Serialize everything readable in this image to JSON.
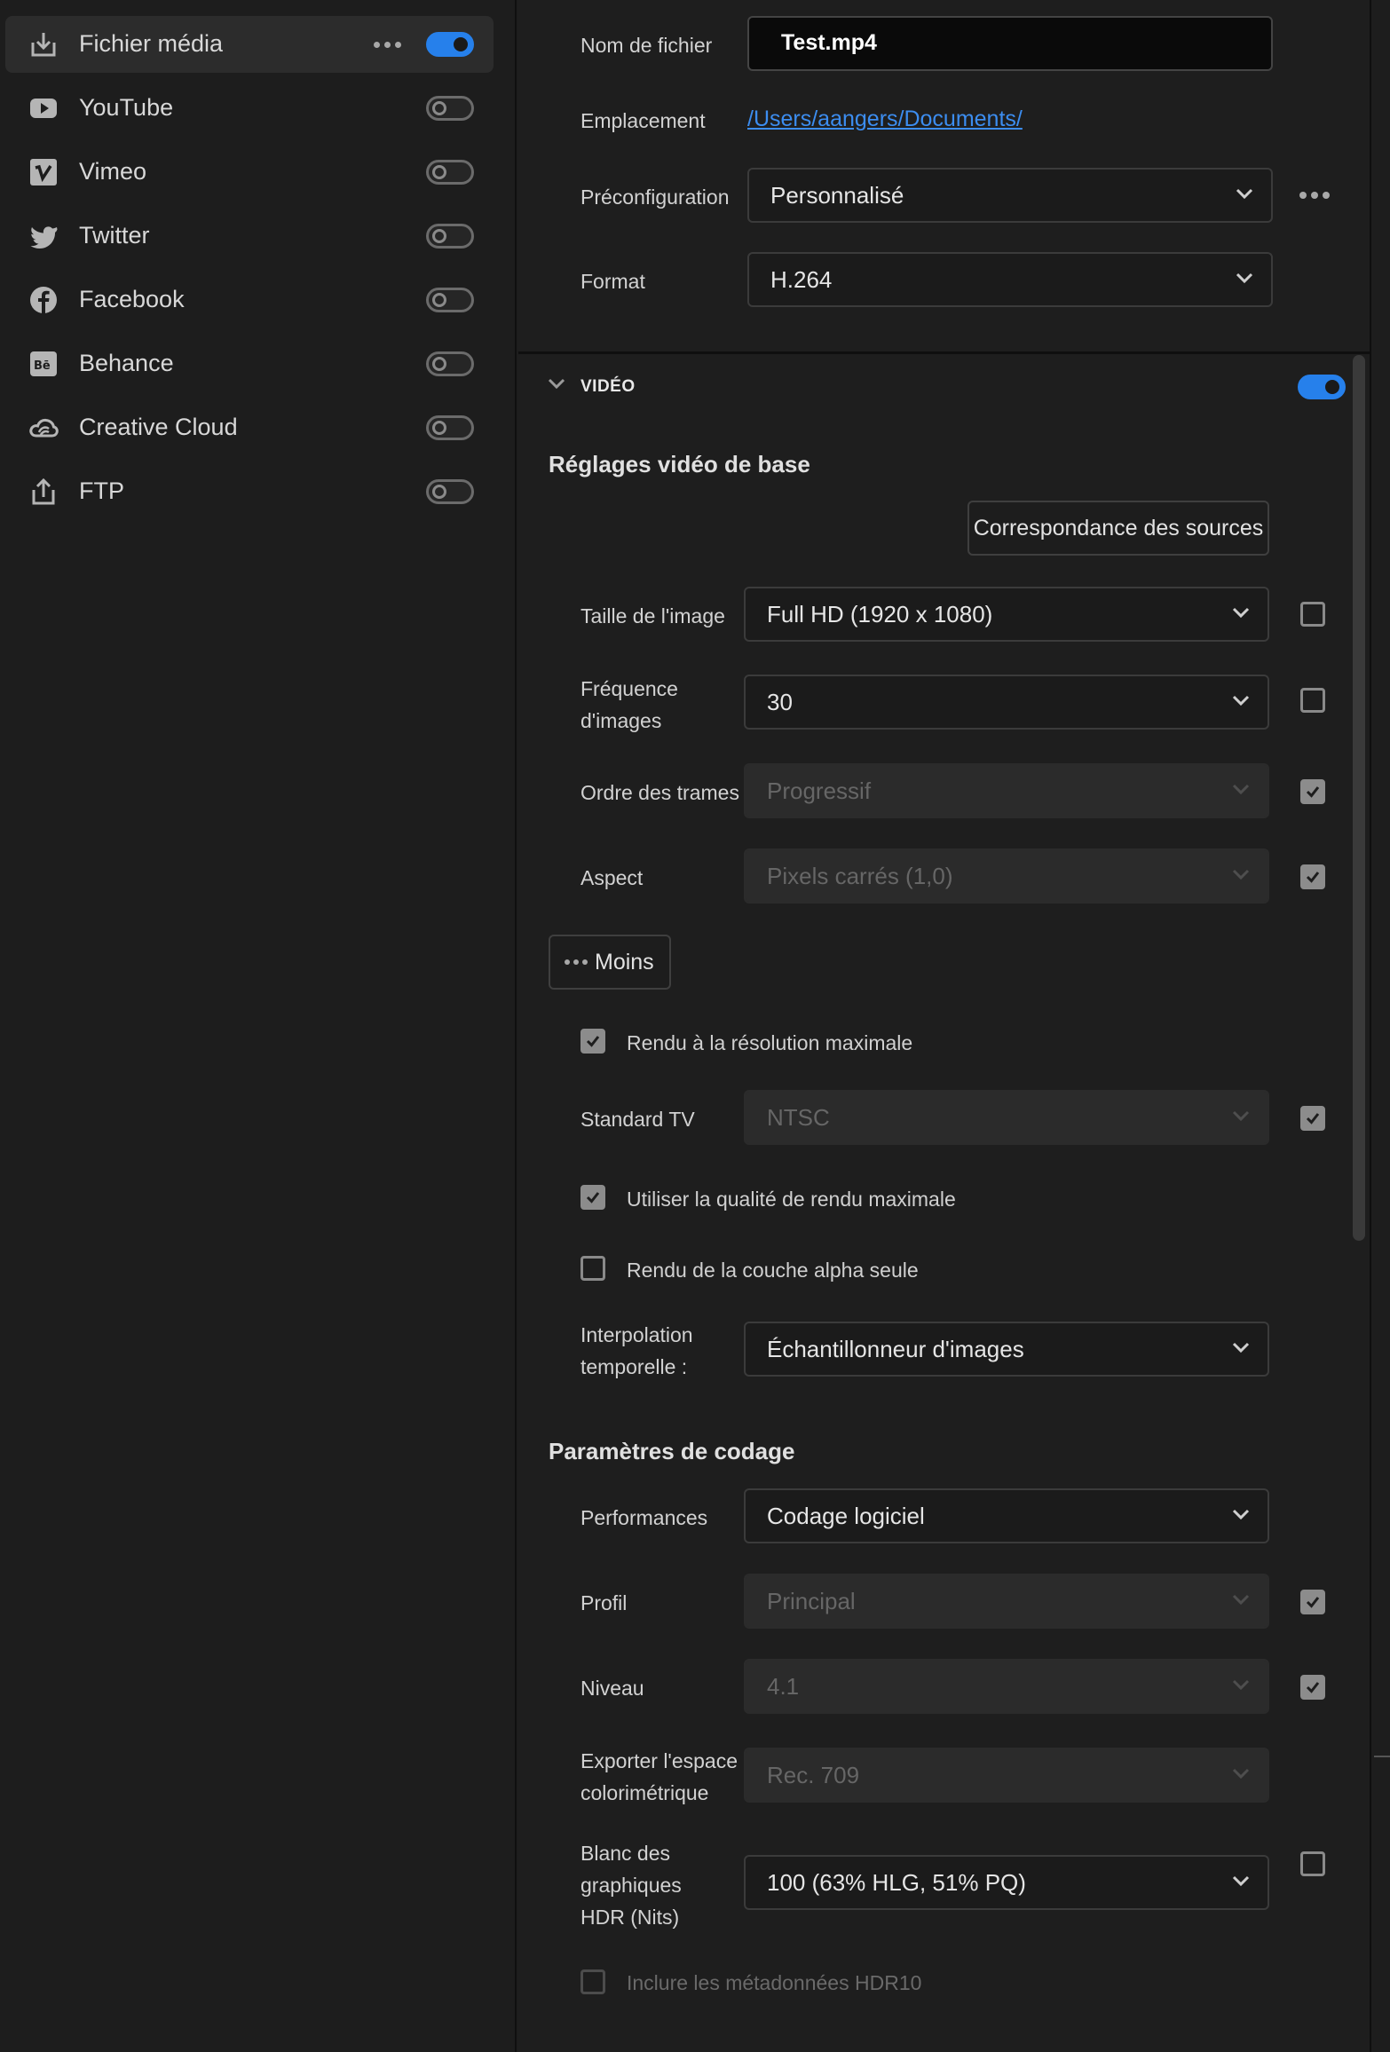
{
  "sidebar": {
    "items": [
      {
        "label": "Fichier média",
        "icon": "download-icon",
        "enabled": true,
        "active": true
      },
      {
        "label": "YouTube",
        "icon": "youtube-icon",
        "enabled": false
      },
      {
        "label": "Vimeo",
        "icon": "vimeo-icon",
        "enabled": false
      },
      {
        "label": "Twitter",
        "icon": "twitter-icon",
        "enabled": false
      },
      {
        "label": "Facebook",
        "icon": "facebook-icon",
        "enabled": false
      },
      {
        "label": "Behance",
        "icon": "behance-icon",
        "enabled": false
      },
      {
        "label": "Creative Cloud",
        "icon": "creative-cloud-icon",
        "enabled": false
      },
      {
        "label": "FTP",
        "icon": "upload-icon",
        "enabled": false
      }
    ]
  },
  "file": {
    "filename_label": "Nom de fichier",
    "filename_value": "Test.mp4",
    "location_label": "Emplacement",
    "location_value": "/Users/aangers/Documents/",
    "preset_label": "Préconfiguration",
    "preset_value": "Personnalisé",
    "format_label": "Format",
    "format_value": "H.264"
  },
  "video": {
    "section_label": "VIDÉO",
    "enabled": true,
    "basic_title": "Réglages vidéo de base",
    "match_source_button": "Correspondance des sources",
    "frame_size_label": "Taille de l'image",
    "frame_size_value": "Full HD (1920 x 1080)",
    "frame_rate_label": "Fréquence d'images",
    "frame_rate_value": "30",
    "field_order_label": "Ordre des trames",
    "field_order_value": "Progressif",
    "aspect_label": "Aspect",
    "aspect_value": "Pixels carrés (1,0)",
    "less_button": "Moins",
    "render_max_depth_label": "Rendu à la résolution maximale",
    "tv_standard_label": "Standard TV",
    "tv_standard_value": "NTSC",
    "max_render_quality_label": "Utiliser la qualité de rendu maximale",
    "alpha_only_label": "Rendu de la couche alpha seule",
    "time_interp_label": "Interpolation temporelle :",
    "time_interp_value": "Échantillonneur d'images"
  },
  "encoding": {
    "title": "Paramètres de codage",
    "performance_label": "Performances",
    "performance_value": "Codage logiciel",
    "profile_label": "Profil",
    "profile_value": "Principal",
    "level_label": "Niveau",
    "level_value": "4.1",
    "color_space_label": "Exporter l'espace colorimétrique",
    "color_space_value": "Rec. 709",
    "hdr_white_label": "Blanc des graphiques HDR (Nits)",
    "hdr_white_value": "100 (63% HLG, 51% PQ)",
    "hdr10_label": "Inclure les métadonnées HDR10"
  },
  "colors": {
    "accent": "#2680eb",
    "link": "#3c8df0",
    "background": "#1d1d1d"
  }
}
